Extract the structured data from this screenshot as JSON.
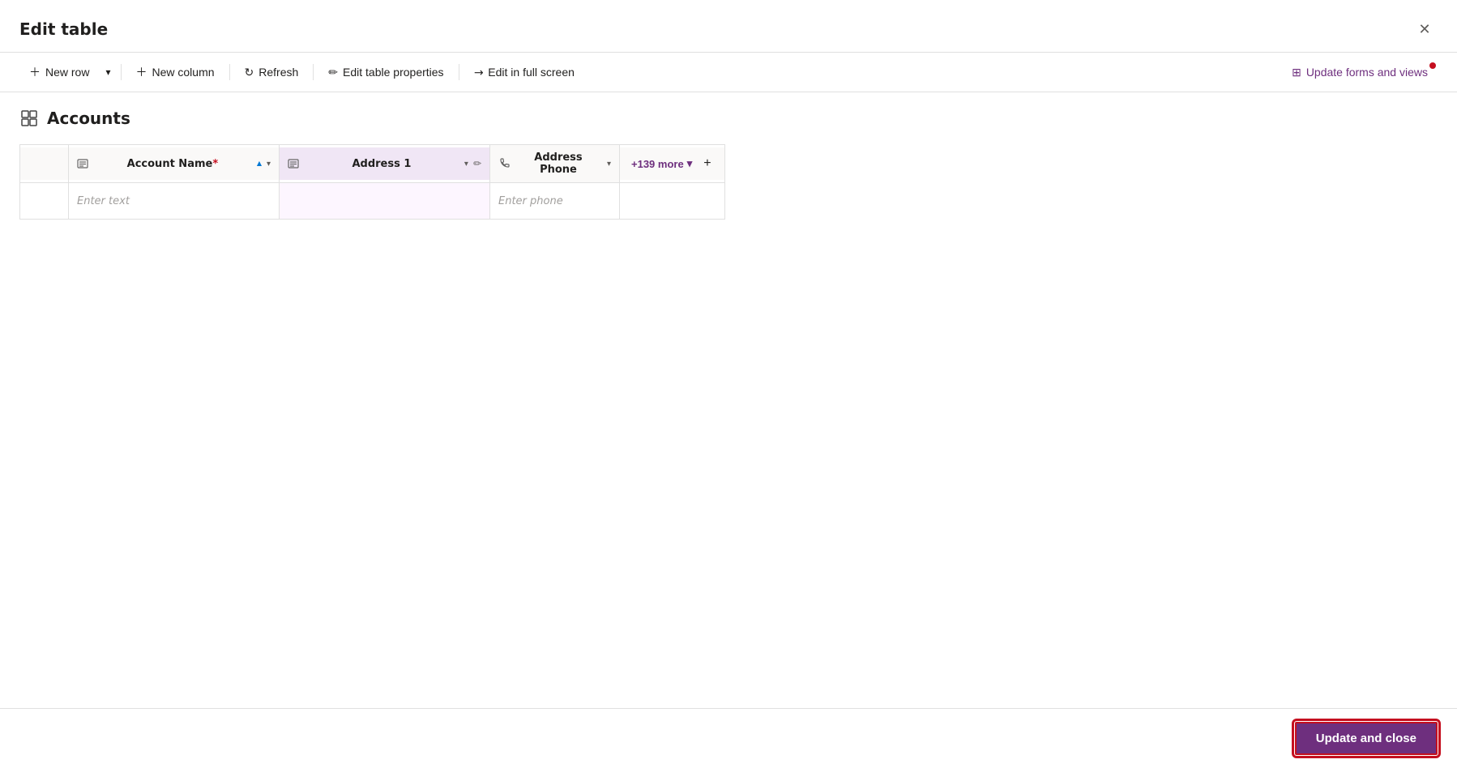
{
  "dialog": {
    "title": "Edit table",
    "close_label": "×"
  },
  "toolbar": {
    "new_row_label": "New row",
    "dropdown_arrow": "▾",
    "new_column_label": "New column",
    "refresh_label": "Refresh",
    "edit_table_props_label": "Edit table properties",
    "edit_fullscreen_label": "Edit in full screen",
    "update_forms_label": "Update forms and views"
  },
  "table_section": {
    "title": "Accounts",
    "columns": [
      {
        "id": "row_num",
        "label": "",
        "type": "row_num"
      },
      {
        "id": "account_name",
        "label": "Account Name",
        "required": true,
        "icon": "text-icon",
        "sort": "asc",
        "placeholder": "Enter text"
      },
      {
        "id": "address1",
        "label": "Address 1",
        "icon": "text-icon",
        "has_edit": true,
        "placeholder": ""
      },
      {
        "id": "address_phone",
        "label": "Address Phone",
        "icon": "phone-icon",
        "placeholder": "Enter phone"
      }
    ],
    "more_columns_label": "+139 more",
    "add_column_label": "+"
  },
  "bottom_bar": {
    "update_close_label": "Update and close"
  }
}
